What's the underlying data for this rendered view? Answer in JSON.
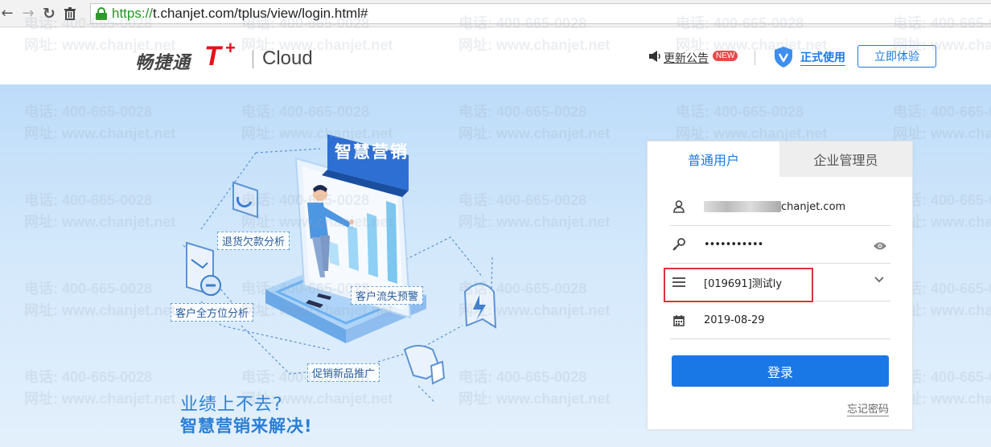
{
  "browser": {
    "url_scheme": "https://",
    "url_rest": "t.chanjet.com/tplus/view/login.html#"
  },
  "header": {
    "logo_cn": "畅捷通",
    "logo_t": "T",
    "logo_plus": "+",
    "logo_cloud": "Cloud",
    "notice": "更新公告",
    "new_badge": "NEW",
    "official": "正式使用",
    "trial": "立即体验"
  },
  "hero": {
    "slogan_1": "业绩上不去?",
    "slogan_2": "智慧营销来解决!",
    "illustration_title": "智慧营销",
    "labels": {
      "returns": "退货欠款分析",
      "customer_analysis": "客户全方位分析",
      "churn": "客户流失预警",
      "promotion": "促销新品推广"
    }
  },
  "watermark": {
    "phone": "电话: 400-665-0028",
    "site": "网址: www.chanjet.net"
  },
  "login": {
    "tabs": [
      "普通用户",
      "企业管理员"
    ],
    "active_tab": 0,
    "username_suffix": "chanjet.com",
    "password_mask": "•••••••••••",
    "account": "[019691]测试ly",
    "date": "2019-08-29",
    "submit": "登录",
    "forgot": "忘记密码"
  },
  "colors": {
    "accent": "#1a78e6",
    "brand_red": "#e4121a",
    "highlight_box": "#d9343b"
  },
  "icons": [
    "back-icon",
    "forward-icon",
    "reload-icon",
    "trash-icon",
    "lock-icon",
    "speaker-icon",
    "shield-icon",
    "user-icon",
    "key-icon",
    "eye-icon",
    "list-icon",
    "chevron-down-icon",
    "calendar-icon"
  ]
}
